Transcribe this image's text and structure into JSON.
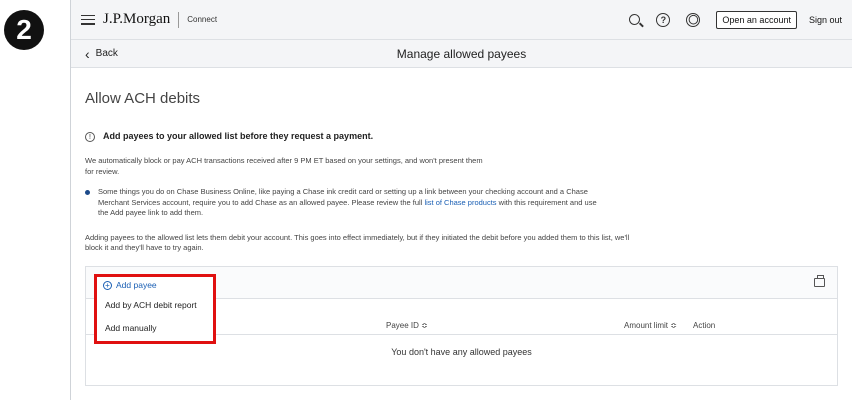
{
  "step": "2",
  "header": {
    "logo": "J.P.Morgan",
    "sublogo": "Connect",
    "open_account": "Open an account",
    "sign_out": "Sign out"
  },
  "subheader": {
    "back": "Back",
    "title": "Manage allowed payees"
  },
  "main": {
    "heading": "Allow ACH debits",
    "notice_title": "Add payees to your allowed list before they request a payment.",
    "notice_text": "We automatically block or pay ACH transactions received after 9 PM ET based on your settings, and won't present them for review.",
    "bullet_text_before": "Some things you do on Chase Business Online, like paying a Chase ink credit card or setting up a link between your checking account and a Chase Merchant Services account, require you to add Chase as an allowed payee. Please review the full ",
    "bullet_link": "list of Chase products",
    "bullet_text_after": " with this requirement and use the Add payee link to add them.",
    "adding_text": "Adding payees to the allowed list lets them debit your account. This goes into effect immediately, but if they initiated the debit before you added them to this list, we'll block it and they'll have to try again."
  },
  "table": {
    "col_payee_id": "Payee ID ≎",
    "col_amount": "Amount limit ≎",
    "col_action": "Action",
    "empty": "You don't have any allowed payees"
  },
  "dropdown": {
    "add_payee": "Add payee",
    "items": [
      "Add by ACH debit report",
      "Add manually"
    ],
    "highlight_color": "#e01010"
  },
  "icons": [
    "menu-icon",
    "search-icon",
    "help-icon",
    "user-icon",
    "back-chevron-icon",
    "info-icon",
    "print-icon",
    "plus-circle-icon"
  ]
}
